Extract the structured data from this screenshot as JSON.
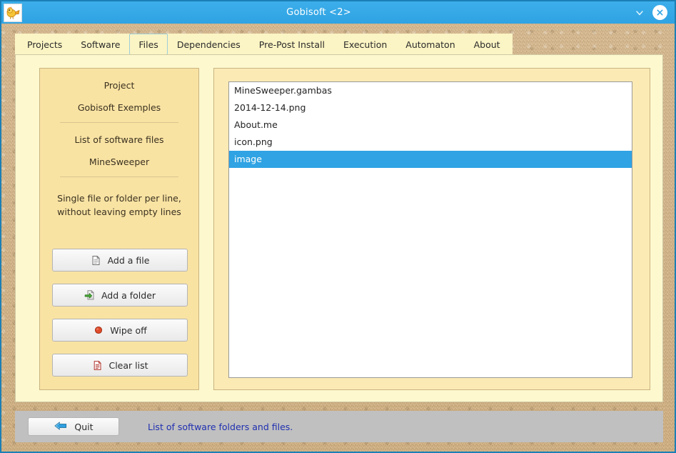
{
  "window": {
    "title": "Gobisoft <2>",
    "app_icon": "gobi-mascot-icon",
    "titlebar_color": "#2fa3e3",
    "controls": {
      "collapse": "chevron-down-icon",
      "close": "close-icon"
    }
  },
  "tabs": [
    {
      "label": "Projects",
      "selected": false
    },
    {
      "label": "Software",
      "selected": false
    },
    {
      "label": "Files",
      "selected": true
    },
    {
      "label": "Dependencies",
      "selected": false
    },
    {
      "label": "Pre-Post Install",
      "selected": false
    },
    {
      "label": "Execution",
      "selected": false
    },
    {
      "label": "Automaton",
      "selected": false
    },
    {
      "label": "About",
      "selected": false
    }
  ],
  "left_panel": {
    "project_label": "Project",
    "project_name": "Gobisoft Exemples",
    "list_label": "List of software files",
    "software_name": "MineSweeper",
    "note_line1": "Single file or folder per line,",
    "note_line2": "without leaving empty lines",
    "buttons": [
      {
        "label": "Add a file",
        "icon": "file-icon"
      },
      {
        "label": "Add a folder",
        "icon": "folder-import-icon"
      },
      {
        "label": "Wipe off",
        "icon": "red-dot-icon"
      },
      {
        "label": "Clear list",
        "icon": "clear-document-icon"
      }
    ]
  },
  "file_list": {
    "selected_index": 4,
    "items": [
      "MineSweeper.gambas",
      "2014-12-14.png",
      "About.me",
      "icon.png",
      "image"
    ],
    "selection_color": "#2fa3e3"
  },
  "status_bar": {
    "quit_label": "Quit",
    "quit_icon": "arrow-left-icon",
    "message": "List of software folders and files.",
    "message_color": "#1f2fb0"
  }
}
